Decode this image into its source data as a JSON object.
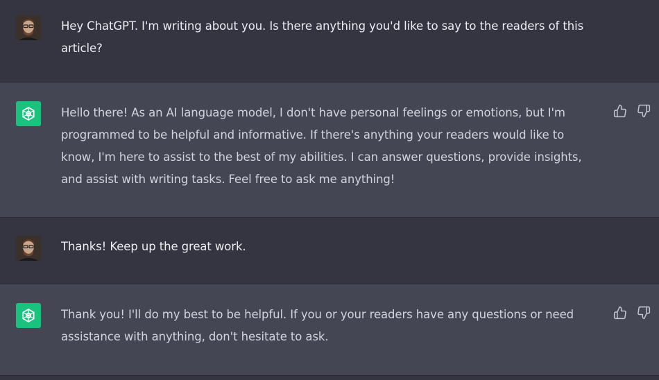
{
  "messages": [
    {
      "role": "user",
      "text": "Hey ChatGPT. I'm writing about you. Is there anything you'd like to say to the readers of this article?"
    },
    {
      "role": "assistant",
      "text": "Hello there! As an AI language model, I don't have personal feelings or emotions, but I'm programmed to be helpful and informative. If there's anything your readers would like to know, I'm here to assist to the best of my abilities. I can answer questions, provide insights, and assist with writing tasks. Feel free to ask me anything!"
    },
    {
      "role": "user",
      "text": "Thanks! Keep up the great work."
    },
    {
      "role": "assistant",
      "text": "Thank you! I'll do my best to be helpful. If you or your readers have any questions or need assistance with anything, don't hesitate to ask."
    }
  ],
  "icons": {
    "user_avatar": "user-avatar-photo",
    "assistant_avatar": "openai-logo-icon",
    "thumbs_up": "thumbs-up-icon",
    "thumbs_down": "thumbs-down-icon"
  },
  "colors": {
    "user_bg": "#343541",
    "assistant_bg": "#444654",
    "assistant_avatar_bg": "#19c37d",
    "text": "#ececf1"
  }
}
